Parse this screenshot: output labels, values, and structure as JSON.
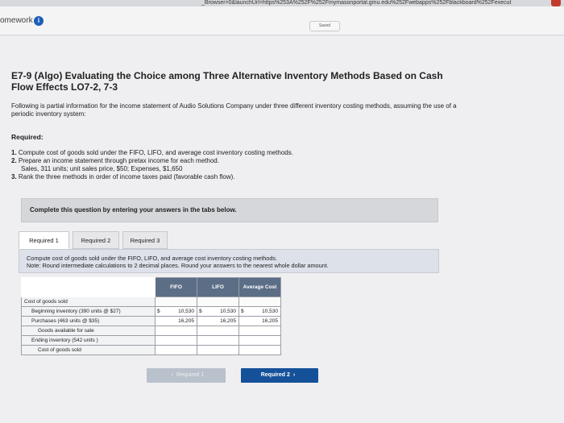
{
  "browser": {
    "url": "_Browser=0&launchUrl=https%253A%252F%252Fmymasonportal.gmu.edu%252Fwebapps%252Fblackboard%252Fexecut"
  },
  "app": {
    "title": "omework",
    "saved_label": "Saved"
  },
  "problem": {
    "title": "E7-9 (Algo) Evaluating the Choice among Three Alternative Inventory Methods Based on Cash Flow Effects LO7-2, 7-3",
    "intro": "Following is partial information for the income statement of Audio Solutions Company under three different inventory costing methods, assuming the use of a periodic inventory system:",
    "required_label": "Required:",
    "requirements": [
      {
        "num": "1.",
        "text": "Compute cost of goods sold under the FIFO, LIFO, and average cost inventory costing methods."
      },
      {
        "num": "2.",
        "text": "Prepare an income statement through pretax income for each method."
      },
      {
        "num": "",
        "text": "Sales, 311 units; unit sales price, $50; Expenses, $1,650"
      },
      {
        "num": "3.",
        "text": "Rank the three methods in order of income taxes paid (favorable cash flow)."
      }
    ],
    "banner": "Complete this question by entering your answers in the tabs below."
  },
  "tabs": [
    {
      "label": "Required 1",
      "active": true
    },
    {
      "label": "Required 2",
      "active": false
    },
    {
      "label": "Required 3",
      "active": false
    }
  ],
  "panel": {
    "instruction": "Compute cost of goods sold under the FIFO, LIFO, and average cost inventory costing methods.",
    "note": "Note: Round intermediate calculations to 2 decimal places. Round your answers to the nearest whole dollar amount."
  },
  "table": {
    "headers": {
      "fifo": "FIFO",
      "lifo": "LIFO",
      "avg": "Average Cost"
    },
    "rows": [
      {
        "label": "Cost of goods sold",
        "fifo": "",
        "lifo": "",
        "avg": "",
        "cur": false
      },
      {
        "label": "Beginning inventory (390 units @ $27)",
        "fifo": "10,530",
        "lifo": "10,530",
        "avg": "10,530",
        "cur": true
      },
      {
        "label": "Purchases (463 units @ $35)",
        "fifo": "16,205",
        "lifo": "16,205",
        "avg": "16,205",
        "cur": false
      },
      {
        "label": "Goods available for sale",
        "fifo": "",
        "lifo": "",
        "avg": "",
        "cur": false
      },
      {
        "label": "Ending inventory (542 units )",
        "fifo": "",
        "lifo": "",
        "avg": "",
        "cur": false
      },
      {
        "label": "Cost of goods sold",
        "fifo": "",
        "lifo": "",
        "avg": "",
        "cur": false
      }
    ],
    "currency": "$"
  },
  "nav": {
    "prev_label": "Required 1",
    "next_label": "Required 2"
  },
  "icons": {
    "info": "info-icon",
    "prev": "chevron-left-icon",
    "next": "chevron-right-icon"
  }
}
